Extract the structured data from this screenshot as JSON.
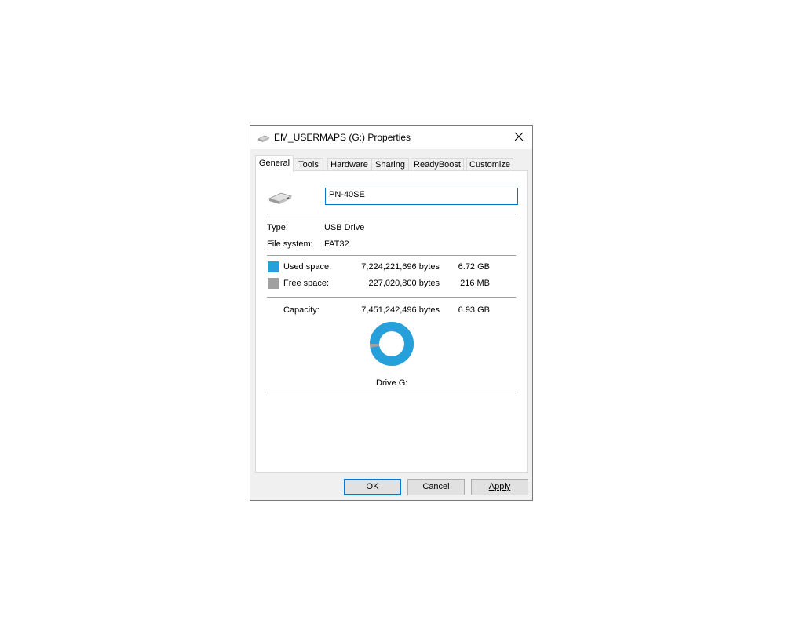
{
  "window": {
    "title": "EM_USERMAPS (G:) Properties"
  },
  "tabs": [
    {
      "label": "General"
    },
    {
      "label": "Tools"
    },
    {
      "label": "Hardware"
    },
    {
      "label": "Sharing"
    },
    {
      "label": "ReadyBoost"
    },
    {
      "label": "Customize"
    }
  ],
  "general": {
    "volume_name": "PN-40SE",
    "type_label": "Type:",
    "type_value": "USB Drive",
    "fs_label": "File system:",
    "fs_value": "FAT32",
    "used": {
      "label": "Used space:",
      "bytes": "7,224,221,696 bytes",
      "size": "6.72 GB",
      "color": "#26a0da"
    },
    "free": {
      "label": "Free space:",
      "bytes": "227,020,800 bytes",
      "size": "216 MB",
      "color": "#a0a0a0"
    },
    "capacity": {
      "label": "Capacity:",
      "bytes": "7,451,242,496 bytes",
      "size": "6.93 GB"
    },
    "used_fraction": 0.9695,
    "drive_label": "Drive G:"
  },
  "buttons": {
    "ok": "OK",
    "cancel": "Cancel",
    "apply": "Apply"
  },
  "icons": {
    "title": "usb-drive-icon",
    "close": "close-icon",
    "drive": "usb-drive-icon"
  }
}
